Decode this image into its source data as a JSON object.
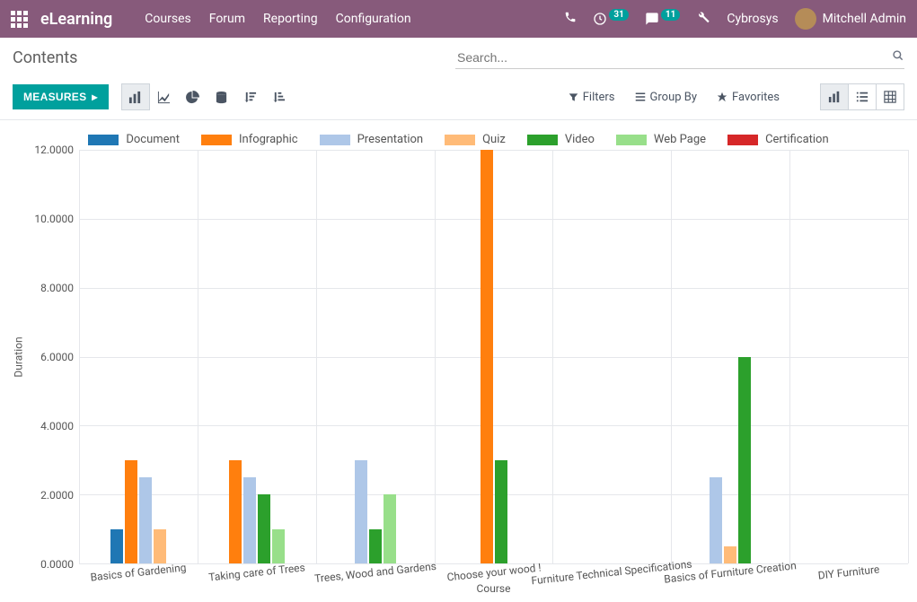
{
  "header": {
    "brand": "eLearning",
    "nav": [
      "Courses",
      "Forum",
      "Reporting",
      "Configuration"
    ],
    "activities_count": "31",
    "messages_count": "11",
    "company": "Cybrosys",
    "user": "Mitchell Admin"
  },
  "page": {
    "title": "Contents"
  },
  "search": {
    "placeholder": "Search..."
  },
  "toolbar": {
    "measures_label": "MEASURES",
    "filters": "Filters",
    "group_by": "Group By",
    "favorites": "Favorites"
  },
  "chart_data": {
    "type": "bar",
    "title": "",
    "xlabel": "Course",
    "ylabel": "Duration",
    "ylim": [
      0,
      12
    ],
    "yticks": [
      0,
      2,
      4,
      6,
      8,
      10,
      12
    ],
    "ytick_labels": [
      "0.0000",
      "2.0000",
      "4.0000",
      "6.0000",
      "8.0000",
      "10.0000",
      "12.0000"
    ],
    "categories": [
      "Basics of Gardening",
      "Taking care of Trees",
      "Trees, Wood and Gardens",
      "Choose your wood !",
      "Furniture Technical Specifications",
      "Basics of Furniture Creation",
      "DIY Furniture"
    ],
    "series": [
      {
        "name": "Document",
        "color": "#1f77b4",
        "values": [
          1.0,
          null,
          null,
          null,
          null,
          null,
          null
        ]
      },
      {
        "name": "Infographic",
        "color": "#ff7f0e",
        "values": [
          3.0,
          3.0,
          null,
          12.0,
          null,
          null,
          null
        ]
      },
      {
        "name": "Presentation",
        "color": "#aec7e8",
        "values": [
          2.5,
          2.5,
          3.0,
          null,
          null,
          2.5,
          null
        ]
      },
      {
        "name": "Quiz",
        "color": "#ffbb78",
        "values": [
          1.0,
          null,
          null,
          null,
          null,
          0.5,
          null
        ]
      },
      {
        "name": "Video",
        "color": "#2ca02c",
        "values": [
          null,
          2.0,
          1.0,
          3.0,
          null,
          6.0,
          null
        ]
      },
      {
        "name": "Web Page",
        "color": "#98df8a",
        "values": [
          null,
          1.0,
          2.0,
          null,
          null,
          null,
          null
        ]
      },
      {
        "name": "Certification",
        "color": "#d62728",
        "values": [
          null,
          null,
          null,
          null,
          null,
          null,
          null
        ]
      }
    ]
  }
}
